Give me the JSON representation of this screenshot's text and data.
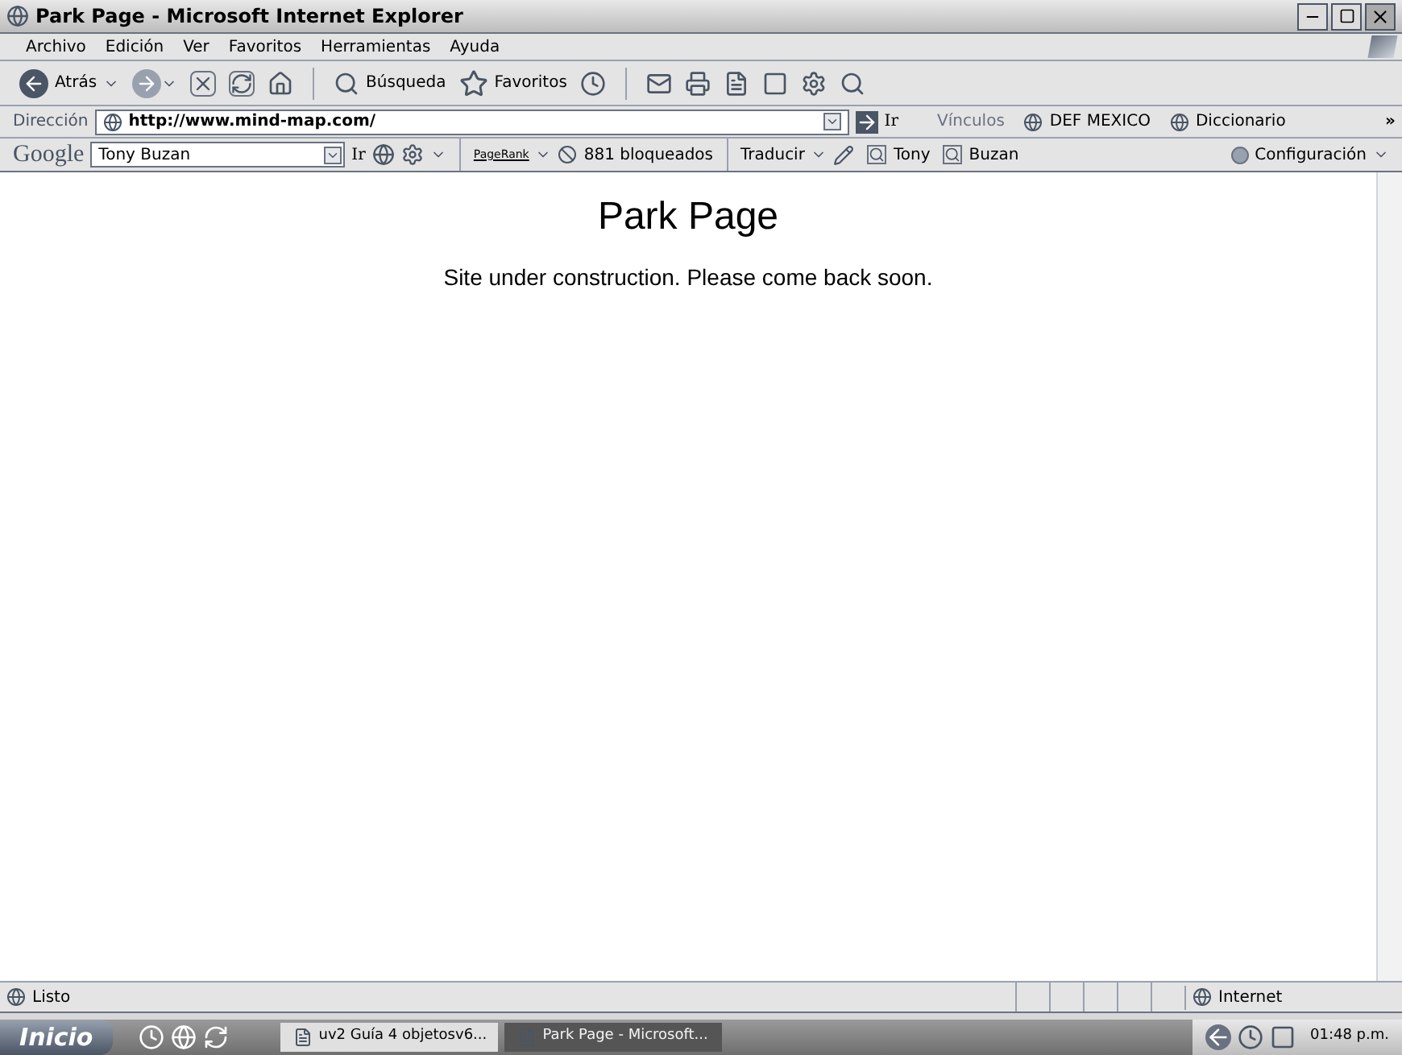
{
  "window": {
    "title": "Park Page - Microsoft Internet Explorer"
  },
  "menu": [
    "Archivo",
    "Edición",
    "Ver",
    "Favoritos",
    "Herramientas",
    "Ayuda"
  ],
  "toolbar": {
    "back": "Atrás",
    "search": "Búsqueda",
    "favorites": "Favoritos"
  },
  "address": {
    "label": "Dirección",
    "value": "http://www.mind-map.com/",
    "go": "Ir",
    "links_label": "Vínculos",
    "links": [
      "DEF MEXICO",
      "Diccionario"
    ],
    "more": "»"
  },
  "google": {
    "logo": "Google",
    "query": "Tony Buzan",
    "go": "Ir",
    "pagerank": "PageRank",
    "blocked": "881 bloqueados",
    "translate": "Traducir",
    "highlights": [
      "Tony",
      "Buzan"
    ],
    "settings": "Configuración"
  },
  "page": {
    "heading": "Park Page",
    "message": "Site under construction. Please come back soon."
  },
  "status_bar": {
    "text": "Listo",
    "zone": "Internet"
  },
  "taskbar": {
    "start": "Inicio",
    "tasks": [
      {
        "label": "uv2 Guía 4 objetosv6...",
        "selected": false
      },
      {
        "label": "Park Page - Microsoft...",
        "selected": true
      }
    ],
    "clock": "01:48 p.m."
  }
}
